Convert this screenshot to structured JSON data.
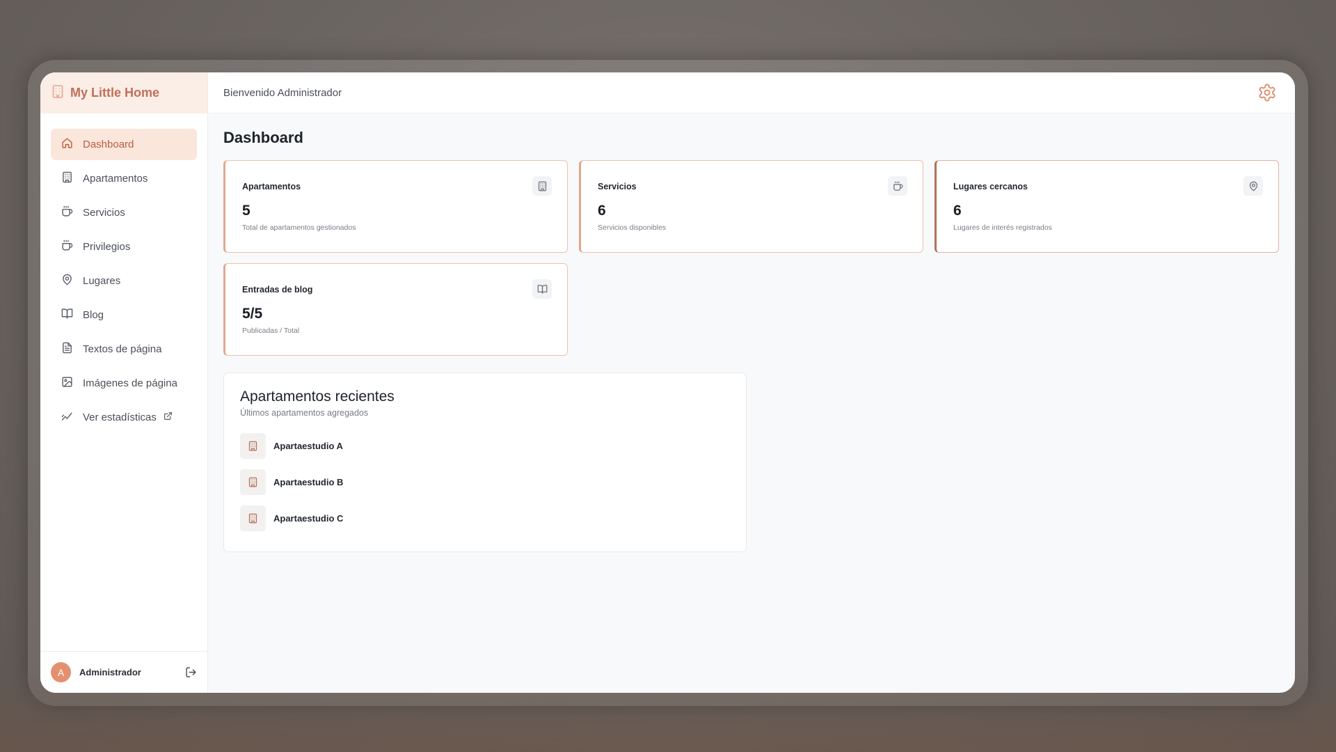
{
  "app": {
    "brand": "My Little Home"
  },
  "sidebar": {
    "items": [
      {
        "label": "Dashboard",
        "icon": "home-icon",
        "active": true
      },
      {
        "label": "Apartamentos",
        "icon": "building-icon"
      },
      {
        "label": "Servicios",
        "icon": "coffee-icon"
      },
      {
        "label": "Privilegios",
        "icon": "coffee-icon"
      },
      {
        "label": "Lugares",
        "icon": "map-pin-icon"
      },
      {
        "label": "Blog",
        "icon": "book-open-icon"
      },
      {
        "label": "Textos de página",
        "icon": "file-text-icon"
      },
      {
        "label": "Imágenes de página",
        "icon": "image-icon"
      },
      {
        "label": "Ver estadísticas",
        "icon": "trending-icon",
        "external": true
      }
    ],
    "user": {
      "initial": "A",
      "name": "Administrador"
    }
  },
  "header": {
    "welcome": "Bienvenido Administrador"
  },
  "dashboard": {
    "title": "Dashboard",
    "cards": [
      {
        "title": "Apartamentos",
        "value": "5",
        "subtitle": "Total de apartamentos gestionados",
        "icon": "building-icon"
      },
      {
        "title": "Servicios",
        "value": "6",
        "subtitle": "Servicios disponibles",
        "icon": "coffee-icon"
      },
      {
        "title": "Lugares cercanos",
        "value": "6",
        "subtitle": "Lugares de interés registrados",
        "icon": "map-pin-icon"
      },
      {
        "title": "Entradas de blog",
        "value": "5/5",
        "subtitle": "Publicadas / Total",
        "icon": "book-open-icon"
      }
    ],
    "recent": {
      "title": "Apartamentos recientes",
      "subtitle": "Últimos apartamentos agregados",
      "items": [
        "Apartaestudio A",
        "Apartaestudio B",
        "Apartaestudio C"
      ]
    }
  },
  "colors": {
    "accent": "#c0705a",
    "active_bg": "#fbe6db",
    "brand_bg": "#fbeee6",
    "avatar": "#e3906f"
  }
}
